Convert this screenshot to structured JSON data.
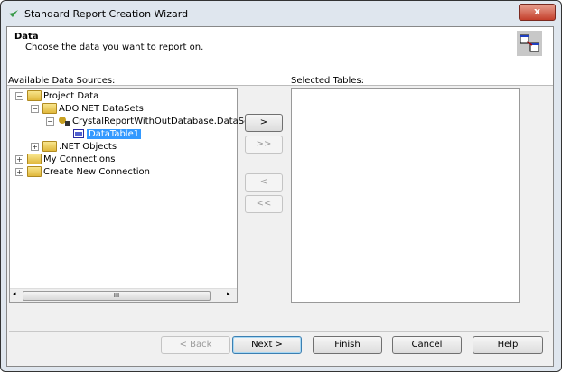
{
  "window": {
    "title": "Standard Report Creation Wizard",
    "close_label": "x"
  },
  "header": {
    "title": "Data",
    "subtitle": "Choose the data you want to report on."
  },
  "available": {
    "label": "Available Data Sources:",
    "tree": [
      {
        "label": "Project Data",
        "toggle": "−"
      },
      {
        "label": "ADO.NET DataSets",
        "toggle": "−"
      },
      {
        "label": "CrystalReportWithOutDatabase.DataSet",
        "toggle": "−"
      },
      {
        "label": "DataTable1"
      },
      {
        "label": ".NET Objects",
        "toggle": "+"
      },
      {
        "label": "My Connections",
        "toggle": "+"
      },
      {
        "label": "Create New Connection",
        "toggle": "+"
      }
    ],
    "scroll_thumb": "III"
  },
  "selected": {
    "label": "Selected Tables:"
  },
  "transfer": {
    "add": ">",
    "add_all": ">>",
    "remove": "<",
    "remove_all": "<<"
  },
  "footer": {
    "back": "< Back",
    "next": "Next >",
    "finish": "Finish",
    "cancel": "Cancel",
    "help": "Help"
  }
}
